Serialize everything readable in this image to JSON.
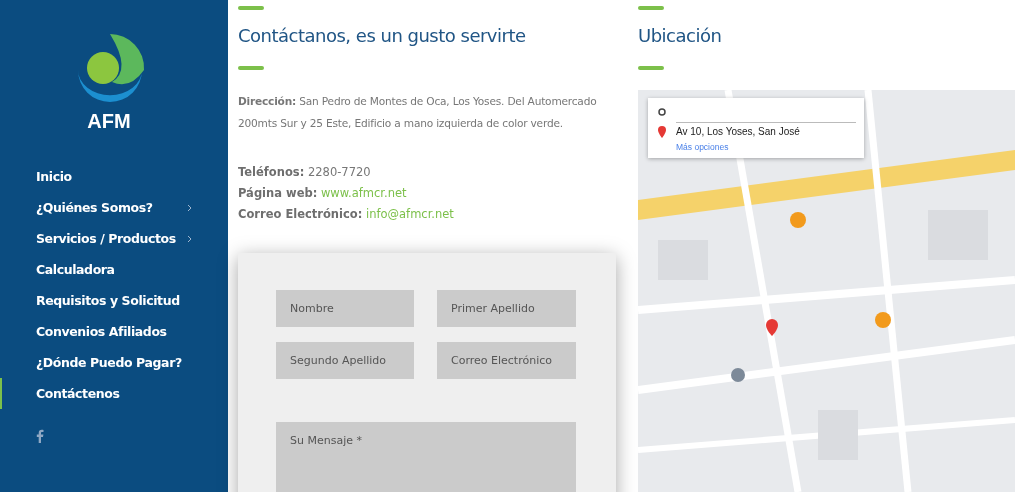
{
  "sidebar": {
    "logo_text": "AFM",
    "items": [
      {
        "label": "Inicio",
        "has_submenu": false,
        "selected": false
      },
      {
        "label": "¿Quiénes Somos?",
        "has_submenu": true,
        "selected": false
      },
      {
        "label": "Servicios / Productos",
        "has_submenu": true,
        "selected": false
      },
      {
        "label": "Calculadora",
        "has_submenu": false,
        "selected": false
      },
      {
        "label": "Requisitos y Solicitud",
        "has_submenu": false,
        "selected": false
      },
      {
        "label": "Convenios Afiliados",
        "has_submenu": false,
        "selected": false
      },
      {
        "label": "¿Dónde Puedo Pagar?",
        "has_submenu": false,
        "selected": false
      },
      {
        "label": "Contáctenos",
        "has_submenu": false,
        "selected": true
      }
    ]
  },
  "contact": {
    "title": "Contáctanos, es un gusto servirte",
    "address": "**Dirección:** San Pedro de Montes de Oca, Los Yoses.  Del Automercado 200mts Sur y 25 Este, Edificio a mano izquierda de color verde.",
    "details": [
      {
        "label": "Teléfonos:",
        "value": "2280-7720",
        "kind": "text"
      },
      {
        "label": "Página web:",
        "value": "www.afmcr.net",
        "kind": "link"
      },
      {
        "label": "Correo Electrónico:",
        "value": "info@afmcr.net",
        "kind": "link"
      }
    ]
  },
  "form": {
    "fields": [
      {
        "placeholder": "Nombre"
      },
      {
        "placeholder": "Primer Apellido"
      },
      {
        "placeholder": "Segundo Apellido"
      },
      {
        "placeholder": "Correo Electrónico"
      }
    ],
    "message": {
      "placeholder": "Su Mensaje *"
    }
  },
  "location": {
    "title": "Ubicación",
    "map": {
      "kind": "picture",
      "destination": "Av 10, Los Yoses, San José",
      "more_link": "Más opciones"
    }
  }
}
